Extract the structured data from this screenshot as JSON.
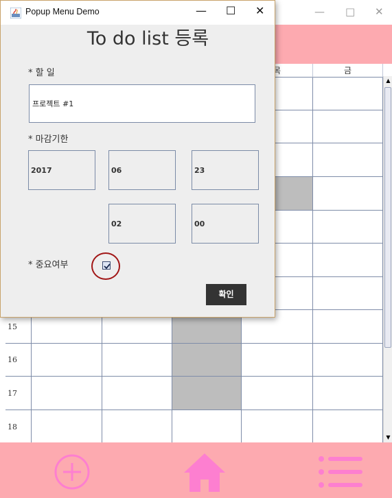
{
  "background_window": {
    "controls": {
      "minimize": "—",
      "maximize": "□",
      "close": "✕"
    },
    "columns": [
      "목",
      "금"
    ],
    "row_labels": [
      "15",
      "16",
      "17",
      "18"
    ],
    "header_color": "#fdaab0",
    "bottom_nav": {
      "icons": [
        "plus-circle-icon",
        "home-icon",
        "list-icon"
      ],
      "icon_color": "#fd7fd0"
    }
  },
  "dialog": {
    "title": "Popup Menu Demo",
    "controls": {
      "minimize": "—",
      "maximize": "☐",
      "close": "✕"
    },
    "heading": "To do list 등록",
    "task_label": "* 할 일",
    "task_value": "프로젝트 #1",
    "deadline_label": "* 마감기한",
    "year": "2017",
    "month": "06",
    "day": "23",
    "hour": "02",
    "minute": "00",
    "important_label": "* 중요여부",
    "important_checked": true,
    "confirm_label": "확인"
  }
}
